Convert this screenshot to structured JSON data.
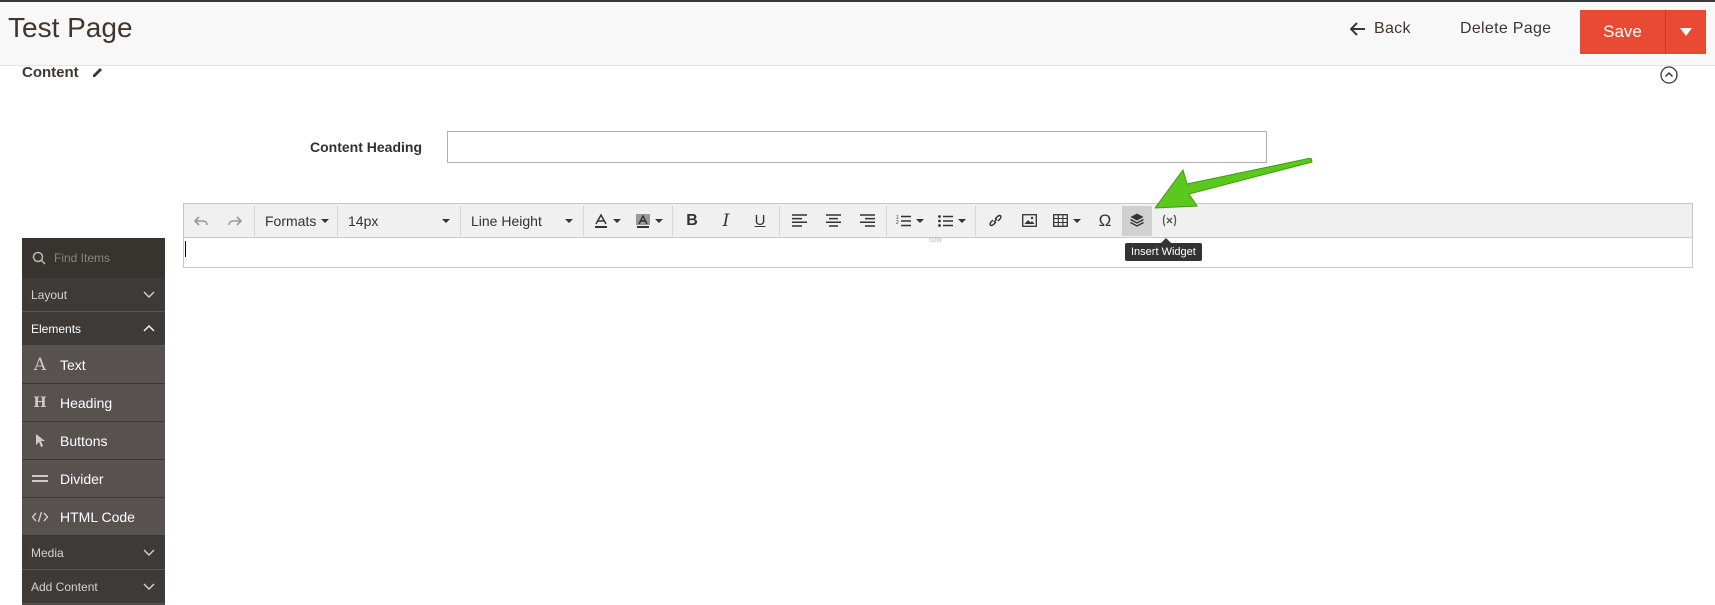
{
  "header": {
    "title": "Test Page",
    "back_label": "Back",
    "delete_label": "Delete Page",
    "save_label": "Save"
  },
  "section": {
    "title": "Content"
  },
  "content_heading": {
    "label": "Content Heading",
    "value": ""
  },
  "panel": {
    "search_placeholder": "Find Items",
    "groups": [
      {
        "label": "Layout"
      },
      {
        "label": "Elements"
      },
      {
        "label": "Media"
      },
      {
        "label": "Add Content"
      }
    ],
    "items": [
      {
        "label": "Text",
        "icon": "text-a-icon"
      },
      {
        "label": "Heading",
        "icon": "heading-h-icon"
      },
      {
        "label": "Buttons",
        "icon": "cursor-icon"
      },
      {
        "label": "Divider",
        "icon": "divider-icon"
      },
      {
        "label": "HTML Code",
        "icon": "code-icon"
      }
    ]
  },
  "toolbar": {
    "formats": "Formats",
    "font_size": "14px",
    "line_height": "Line Height",
    "tooltip": "Insert Widget"
  },
  "editor": {
    "row_label": "row"
  },
  "colors": {
    "save": "#e94a33",
    "panel": "#4a4542",
    "arrow": "#5ac81c"
  }
}
